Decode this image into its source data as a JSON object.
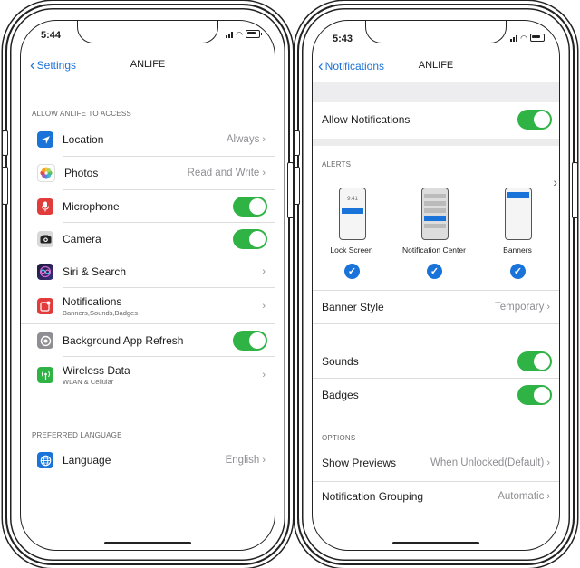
{
  "left": {
    "time": "5:44",
    "back_label": "Settings",
    "title": "ANLIFE",
    "section1": "ALLOW ANLIFE TO ACCESS",
    "rows": [
      {
        "label": "Location",
        "value": "Always",
        "icon": "location-arrow-icon",
        "color": "#1a73d9"
      },
      {
        "label": "Photos",
        "value": "Read and Write",
        "icon": "photos-flower-icon",
        "color": "#f4a623"
      },
      {
        "label": "Microphone",
        "icon": "microphone-icon",
        "color": "#e23b3b"
      },
      {
        "label": "Camera",
        "icon": "camera-icon",
        "color": "#3a3a3c"
      },
      {
        "label": "Siri & Search",
        "icon": "siri-icon",
        "color": "#4b3fa8"
      },
      {
        "label": "Notifications",
        "sub": "Banners,Sounds,Badges",
        "icon": "notification-icon",
        "color": "#e23b3b"
      },
      {
        "label": "Background App Refresh",
        "icon": "gear-icon",
        "color": "#8e8e93"
      },
      {
        "label": "Wireless Data",
        "sub": "WLAN & Cellular",
        "icon": "antenna-icon",
        "color": "#2fb344"
      }
    ],
    "section2": "PREFERRED LANGUAGE",
    "language": {
      "label": "Language",
      "value": "English",
      "icon": "globe-icon",
      "color": "#1a73d9"
    }
  },
  "right": {
    "time": "5:43",
    "back_label": "Notifications",
    "title": "ANLIFE",
    "allow_label": "Allow Notifications",
    "alerts_header": "ALERTS",
    "alert_lock_label": "Lock Screen",
    "alert_lock_time": "9:41",
    "alert_center_label": "Notification Center",
    "alert_banners_label": "Banners",
    "banner_style_label": "Banner Style",
    "banner_style_value": "Temporary",
    "sounds_label": "Sounds",
    "badges_label": "Badges",
    "options_header": "OPTIONS",
    "show_previews_label": "Show Previews",
    "show_previews_value": "When Unlocked(Default)",
    "grouping_label": "Notification Grouping",
    "grouping_value": "Automatic"
  },
  "colors": {
    "accent": "#1a73d9",
    "toggle_on": "#2fb344"
  }
}
